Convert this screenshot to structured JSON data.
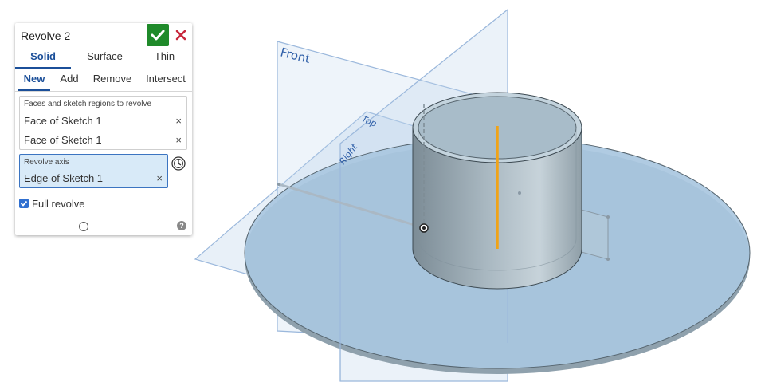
{
  "feature_dialog": {
    "title": "Revolve 2",
    "accept_icon": "checkmark-icon",
    "cancel_icon": "close-icon",
    "type_tabs": [
      {
        "label": "Solid",
        "active": true
      },
      {
        "label": "Surface",
        "active": false
      },
      {
        "label": "Thin",
        "active": false
      }
    ],
    "operation_tabs": [
      {
        "label": "New",
        "active": true
      },
      {
        "label": "Add",
        "active": false
      },
      {
        "label": "Remove",
        "active": false
      },
      {
        "label": "Intersect",
        "active": false
      }
    ],
    "regions_field": {
      "label": "Faces and sketch regions to revolve",
      "items": [
        "Face of Sketch 1",
        "Face of Sketch 1"
      ],
      "remove_glyph": "×"
    },
    "axis_field": {
      "label": "Revolve axis",
      "value": "Edge of Sketch 1",
      "remove_glyph": "×"
    },
    "history_icon": "clock-icon",
    "full_revolve": {
      "label": "Full revolve",
      "checked": true
    },
    "slider": {
      "value": 0.7
    },
    "help_icon": "help-icon",
    "help_glyph": "?"
  },
  "viewport": {
    "planes": {
      "front": "Front",
      "top": "Top",
      "right": "Right"
    },
    "colors": {
      "plane_fill": "#a8c4e4",
      "plane_edge": "#8fb0d6",
      "disc_fill": "#a9c7e0",
      "cylinder_fill": "#8d9ea8",
      "axis_highlight": "#f0a318",
      "label": "#2f5fa8"
    }
  }
}
